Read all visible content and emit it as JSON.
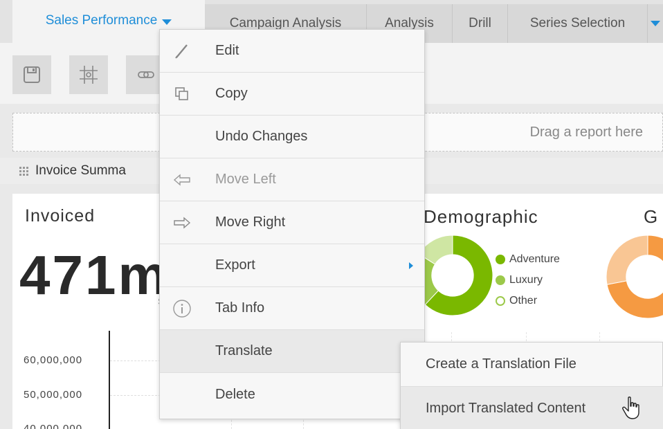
{
  "tabs": [
    {
      "label": "Sales Performance",
      "active": true
    },
    {
      "label": "Campaign Analysis",
      "active": false
    },
    {
      "label": "Analysis",
      "active": false
    },
    {
      "label": "Drill",
      "active": false
    },
    {
      "label": "Series Selection",
      "active": false
    }
  ],
  "toolbar": {
    "icons": [
      "save-icon",
      "grid-icon",
      "link-icon"
    ]
  },
  "dropzone": {
    "text": "Drag a report here"
  },
  "reportbar": {
    "title": "Invoice Summa"
  },
  "panel": {
    "invoiced_title": "Invoiced",
    "invoiced_value": "471m",
    "small_label": "S",
    "demographic_title": "Demographic",
    "g_title": "G",
    "legend": [
      {
        "label": "Adventure",
        "color": "#7ab800"
      },
      {
        "label": "Luxury",
        "color": "#9cc94a"
      },
      {
        "label": "Other",
        "color": "#c2e08a"
      }
    ],
    "axis_labels": [
      "60,000,000",
      "50,000,000",
      "40,000,000"
    ]
  },
  "chart_data": [
    {
      "type": "pie",
      "title": "Demographic",
      "categories": [
        "Adventure",
        "Luxury",
        "Other"
      ],
      "values": [
        62,
        22,
        16
      ],
      "colors": [
        "#7ab800",
        "#9cc94a",
        "#cfe6a3"
      ]
    },
    {
      "type": "pie",
      "title": "G",
      "categories": [],
      "values": [
        72,
        28
      ],
      "colors": [
        "#f59a42",
        "#f9c694"
      ]
    }
  ],
  "menu": {
    "items": [
      {
        "label": "Edit",
        "icon": "pencil-icon",
        "disabled": false
      },
      {
        "label": "Copy",
        "icon": "copy-icon",
        "disabled": false
      },
      {
        "label": "Undo Changes",
        "icon": "",
        "disabled": false
      },
      {
        "label": "Move Left",
        "icon": "arrow-left-icon",
        "disabled": true
      },
      {
        "label": "Move Right",
        "icon": "arrow-right-icon",
        "disabled": false
      },
      {
        "label": "Export",
        "icon": "",
        "disabled": false,
        "submenu": true
      },
      {
        "label": "Tab Info",
        "icon": "info-icon",
        "disabled": false
      },
      {
        "label": "Translate",
        "icon": "",
        "disabled": false,
        "highlight": true
      },
      {
        "label": "Delete",
        "icon": "",
        "disabled": false
      }
    ]
  },
  "submenu": {
    "items": [
      {
        "label": "Create a Translation File"
      },
      {
        "label": "Import Translated Content"
      }
    ]
  },
  "colors": {
    "accent": "#1f8ed8",
    "green": "#7ab800",
    "orange": "#f59a42"
  }
}
